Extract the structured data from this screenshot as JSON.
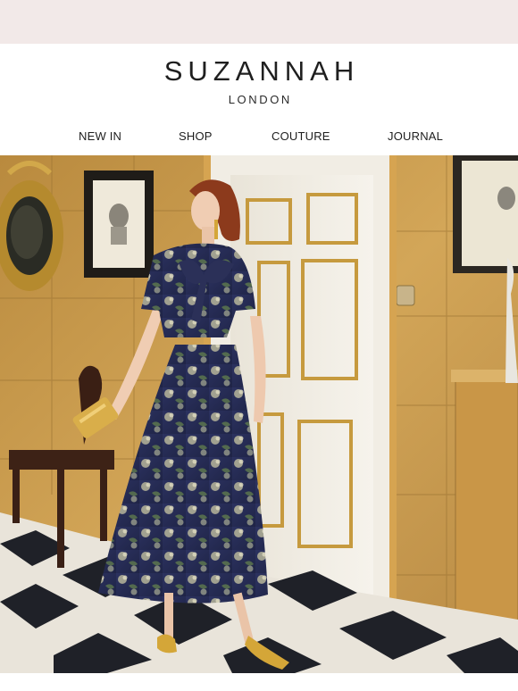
{
  "brand": {
    "name": "SUZANNAH",
    "location": "LONDON"
  },
  "nav": {
    "items": [
      {
        "label": "NEW IN"
      },
      {
        "label": "SHOP"
      },
      {
        "label": "COUTURE"
      },
      {
        "label": "JOURNAL"
      }
    ]
  },
  "hero": {
    "photo": "model in navy floral print midi dress with tie-neck bow, gold bag and gold heels, in a hallway with ochre tiled walls, white panelled door and checkered marble floor"
  },
  "colors": {
    "top_band": "#f2e9e8",
    "wall": "#c99a4c",
    "door": "#f2efe6",
    "dress": "#2b3058",
    "gold": "#d4a638"
  }
}
